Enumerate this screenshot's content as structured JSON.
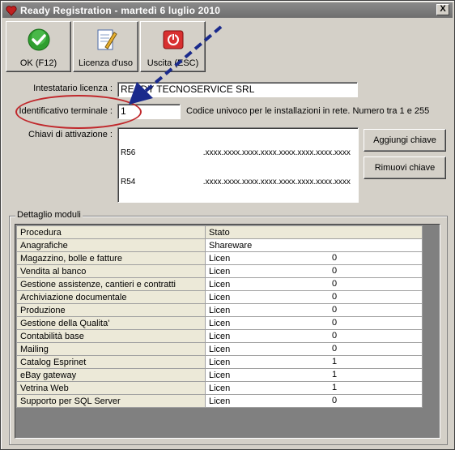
{
  "window": {
    "title": "Ready Registration - martedì 6 luglio 2010",
    "close_label": "X"
  },
  "toolbar": [
    {
      "name": "ok-button",
      "label": "OK (F12)",
      "icon": "check-icon"
    },
    {
      "name": "licenza-button",
      "label": "Licenza d'uso",
      "icon": "document-pen-icon"
    },
    {
      "name": "uscita-button",
      "label": "Uscita (ESC)",
      "icon": "power-icon"
    }
  ],
  "form": {
    "intestatario_label": "Intestatario licenza :",
    "intestatario_value": "READY TECNOSERVICE SRL",
    "identificativo_label": "Identificativo terminale :",
    "identificativo_value": "1",
    "identificativo_hint": "Codice univoco per le installazioni in rete. Numero tra 1 e 255",
    "chiavi_label": "Chiavi di attivazione :",
    "chiavi_lines": [
      "R56                              .xxxx.xxxx.xxxx.xxxx.xxxx.xxxx.xxxx.xxxx",
      "R54                              .xxxx.xxxx.xxxx.xxxx.xxxx.xxxx.xxxx.xxxx"
    ],
    "aggiungi_label": "Aggiungi chiave",
    "rimuovi_label": "Rimuovi chiave"
  },
  "moduli": {
    "group_title": "Dettaglio moduli",
    "columns": [
      "Procedura",
      "Stato"
    ],
    "rows": [
      {
        "procedura": "Anagrafiche",
        "stato": "Shareware",
        "tail": ""
      },
      {
        "procedura": "Magazzino, bolle e fatture",
        "stato": "Licen",
        "tail": "0"
      },
      {
        "procedura": "Vendita al banco",
        "stato": "Licen",
        "tail": "0"
      },
      {
        "procedura": "Gestione assistenze, cantieri e contratti",
        "stato": "Licen",
        "tail": "0"
      },
      {
        "procedura": "Archiviazione documentale",
        "stato": "Licen",
        "tail": "0"
      },
      {
        "procedura": "Produzione",
        "stato": "Licen",
        "tail": "0"
      },
      {
        "procedura": "Gestione della Qualita'",
        "stato": "Licen",
        "tail": "0"
      },
      {
        "procedura": "Contabilità base",
        "stato": "Licen",
        "tail": "0"
      },
      {
        "procedura": "Mailing",
        "stato": "Licen",
        "tail": "0"
      },
      {
        "procedura": "Catalog Esprinet",
        "stato": "Licen",
        "tail": "1"
      },
      {
        "procedura": "eBay gateway",
        "stato": "Licen",
        "tail": "1"
      },
      {
        "procedura": "Vetrina Web",
        "stato": "Licen",
        "tail": "1"
      },
      {
        "procedura": "Supporto per SQL Server",
        "stato": "Licen",
        "tail": "0"
      }
    ]
  },
  "colors": {
    "annotation_arrow": "#1a2a8c",
    "annotation_ellipse": "#c0282c"
  }
}
